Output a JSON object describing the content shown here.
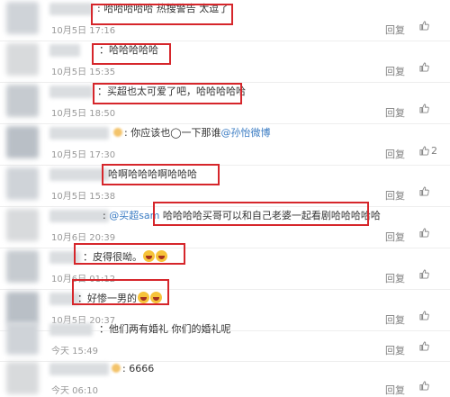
{
  "comments": [
    {
      "text": "哈哈哈哈哈 热搜警告 太逗了",
      "time": "10月5日 17:16",
      "reply": "回复",
      "likes": ""
    },
    {
      "text": "哈哈哈哈哈",
      "time": "10月5日 15:35",
      "reply": "回复",
      "likes": ""
    },
    {
      "text": "买超也太可爱了吧，哈哈哈哈哈",
      "time": "10月5日 18:50",
      "reply": "回复",
      "likes": ""
    },
    {
      "text": "你应该也◯一下那谁",
      "mention": "@孙怡微博",
      "time": "10月5日 17:30",
      "reply": "回复",
      "likes": "2"
    },
    {
      "text": "哈啊哈哈哈啊哈哈哈",
      "time": "10月5日 15:38",
      "reply": "回复",
      "likes": ""
    },
    {
      "mention": "@买超sam",
      "text": "哈哈哈哈买哥可以和自己老婆一起看剧哈哈哈哈哈",
      "time": "10月6日 20:39",
      "reply": "回复",
      "likes": ""
    },
    {
      "text": "皮得很呦。",
      "time": "10月6日 01:12",
      "reply": "回复",
      "likes": ""
    },
    {
      "text": "好惨一男的",
      "time": "10月5日 20:37",
      "reply": "回复",
      "likes": ""
    },
    {
      "text": "他们两有婚礼 你们的婚礼呢",
      "time": "今天 15:49",
      "reply": "回复",
      "likes": ""
    },
    {
      "text": "6666",
      "time": "今天 06:10",
      "reply": "回复",
      "likes": ""
    }
  ]
}
